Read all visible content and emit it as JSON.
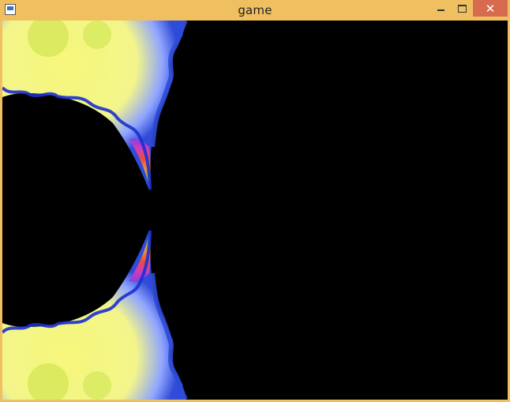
{
  "window": {
    "title": "game",
    "close_glyph": "✕",
    "icons": {
      "app": "app-window-icon",
      "minimize": "minimize-icon",
      "maximize": "maximize-icon",
      "close": "close-icon"
    },
    "colors": {
      "frame": "#f0c060",
      "close_button": "#d86b4f",
      "canvas_background": "#000000"
    }
  },
  "canvas": {
    "content": "fractal",
    "palette": [
      "#f6f77a",
      "#c9e34a",
      "#6fd34e",
      "#4aa3ff",
      "#2f4bd8",
      "#8b3ee0",
      "#e43ab8",
      "#ff4d2d",
      "#ff9b2a"
    ]
  }
}
